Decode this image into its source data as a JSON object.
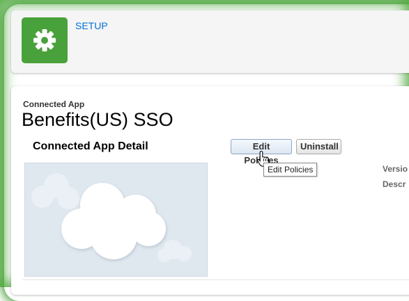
{
  "header": {
    "setup_label": "SETUP",
    "setup_icon": "gear-icon",
    "accent_color": "#49a13b",
    "link_color": "#0070d2"
  },
  "app": {
    "eyebrow": "Connected App",
    "title": "Benefits(US) SSO"
  },
  "detail": {
    "section_title": "Connected App Detail",
    "buttons": {
      "edit_policies": "Edit Policies",
      "uninstall": "Uninstall"
    },
    "tooltip": "Edit Policies",
    "fields": {
      "version_label": "Versio",
      "description_label": "Descr"
    },
    "logo_icon": "cloud-placeholder-icon"
  }
}
